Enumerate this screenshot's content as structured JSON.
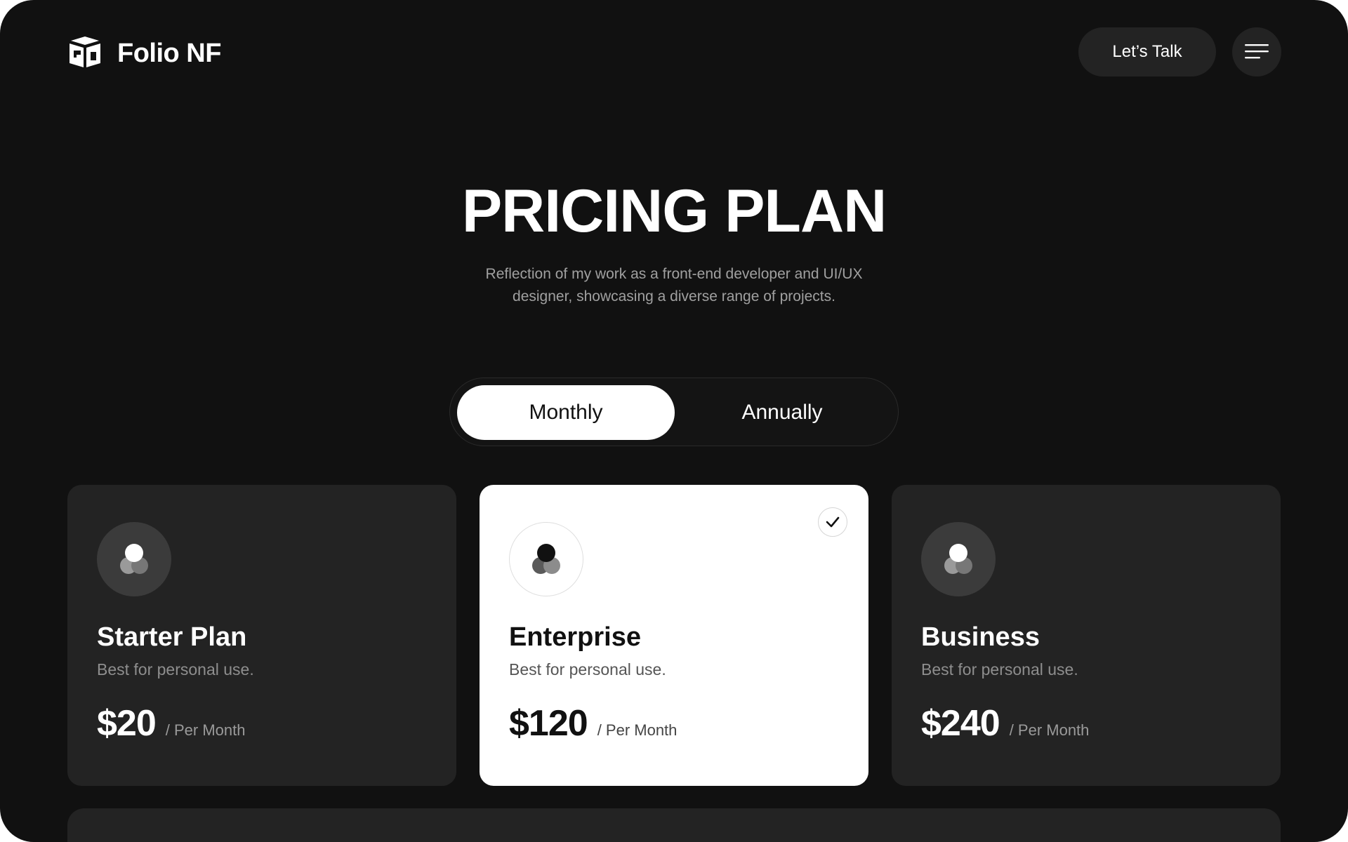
{
  "header": {
    "brand": "Folio NF",
    "logo_icon": "cube-logo-icon",
    "talk_label": "Let’s Talk",
    "menu_icon": "hamburger-menu-icon"
  },
  "hero": {
    "title": "PRICING PLAN",
    "subtitle_line1": "Reflection of my work as a front-end developer and UI/UX",
    "subtitle_line2": "designer, showcasing a diverse range of projects."
  },
  "billing_toggle": {
    "options": [
      "Monthly",
      "Annually"
    ],
    "selected": "Monthly"
  },
  "plans": [
    {
      "name": "Starter Plan",
      "description": "Best for personal use.",
      "price": "$20",
      "period": "/ Per Month",
      "selected": false
    },
    {
      "name": "Enterprise",
      "description": "Best for personal use.",
      "price": "$120",
      "period": "/ Per Month",
      "selected": true
    },
    {
      "name": "Business",
      "description": "Best for personal use.",
      "price": "$240",
      "period": "/ Per Month",
      "selected": false
    }
  ],
  "colors": {
    "background": "#111111",
    "card": "#232323",
    "card_selected": "#ffffff",
    "text_primary": "#ffffff",
    "text_muted": "#a0a0a0"
  }
}
